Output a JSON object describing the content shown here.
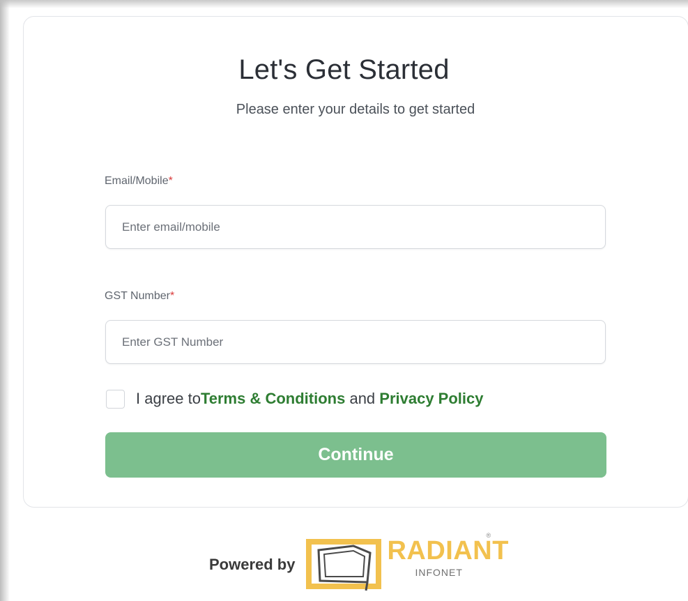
{
  "form": {
    "title": "Let's Get Started",
    "subtitle": "Please enter your details to get started",
    "email": {
      "label": "Email/Mobile",
      "required_mark": "*",
      "placeholder": "Enter email/mobile",
      "value": ""
    },
    "gst": {
      "label": "GST Number",
      "required_mark": "*",
      "placeholder": "Enter GST Number",
      "value": ""
    },
    "agree": {
      "prefix": "I agree to",
      "terms_link": "Terms & Conditions",
      "middle": " and ",
      "privacy_link": "Privacy Policy",
      "checked": false
    },
    "continue_label": "Continue"
  },
  "footer": {
    "powered_by": "Powered by",
    "logo_word": "RADIANT",
    "logo_sub": "INFONET",
    "logo_reg": "®"
  },
  "colors": {
    "primary_button": "#7cbf8e",
    "link": "#2e7d32",
    "required": "#d93a3a",
    "logo_yellow": "#f2c14e"
  },
  "icons": {
    "logo": "radiant-infonet-logo-icon"
  }
}
